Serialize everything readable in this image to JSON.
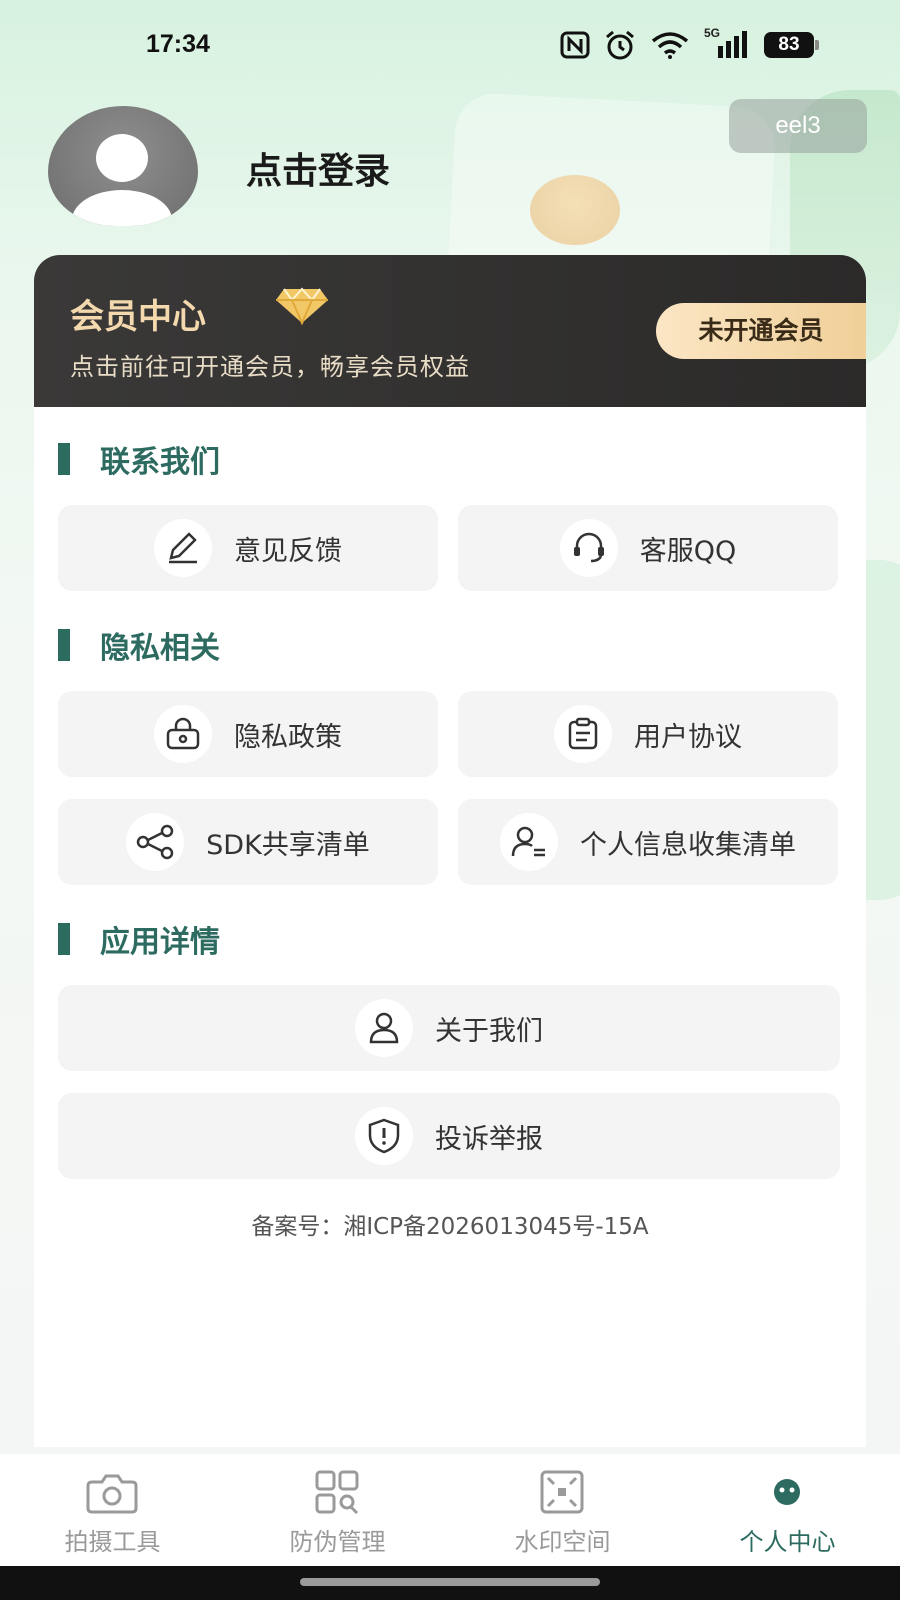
{
  "status_bar": {
    "time": "17:34",
    "network": "5G",
    "battery": "83"
  },
  "profile": {
    "login_label": "点击登录",
    "badge": "eel3"
  },
  "member": {
    "title": "会员中心",
    "subtitle": "点击前往可开通会员，畅享会员权益",
    "button": "未开通会员"
  },
  "sections": {
    "contact": {
      "title": "联系我们",
      "feedback": "意见反馈",
      "service_qq": "客服QQ"
    },
    "privacy": {
      "title": "隐私相关",
      "policy": "隐私政策",
      "agreement": "用户协议",
      "sdk_list": "SDK共享清单",
      "info_list": "个人信息收集清单"
    },
    "app": {
      "title": "应用详情",
      "about": "关于我们",
      "report": "投诉举报"
    }
  },
  "icp": "备案号：湘ICP备2026013045号-15A",
  "nav": [
    {
      "label": "拍摄工具",
      "icon": "camera-icon"
    },
    {
      "label": "防伪管理",
      "icon": "qr-scan-icon"
    },
    {
      "label": "水印空间",
      "icon": "watermark-icon"
    },
    {
      "label": "个人中心",
      "icon": "profile-face-icon",
      "active": true
    }
  ],
  "colors": {
    "accent": "#2d6b61",
    "member_gold": "#f3d9ad",
    "member_bg": "#2b2a29"
  }
}
